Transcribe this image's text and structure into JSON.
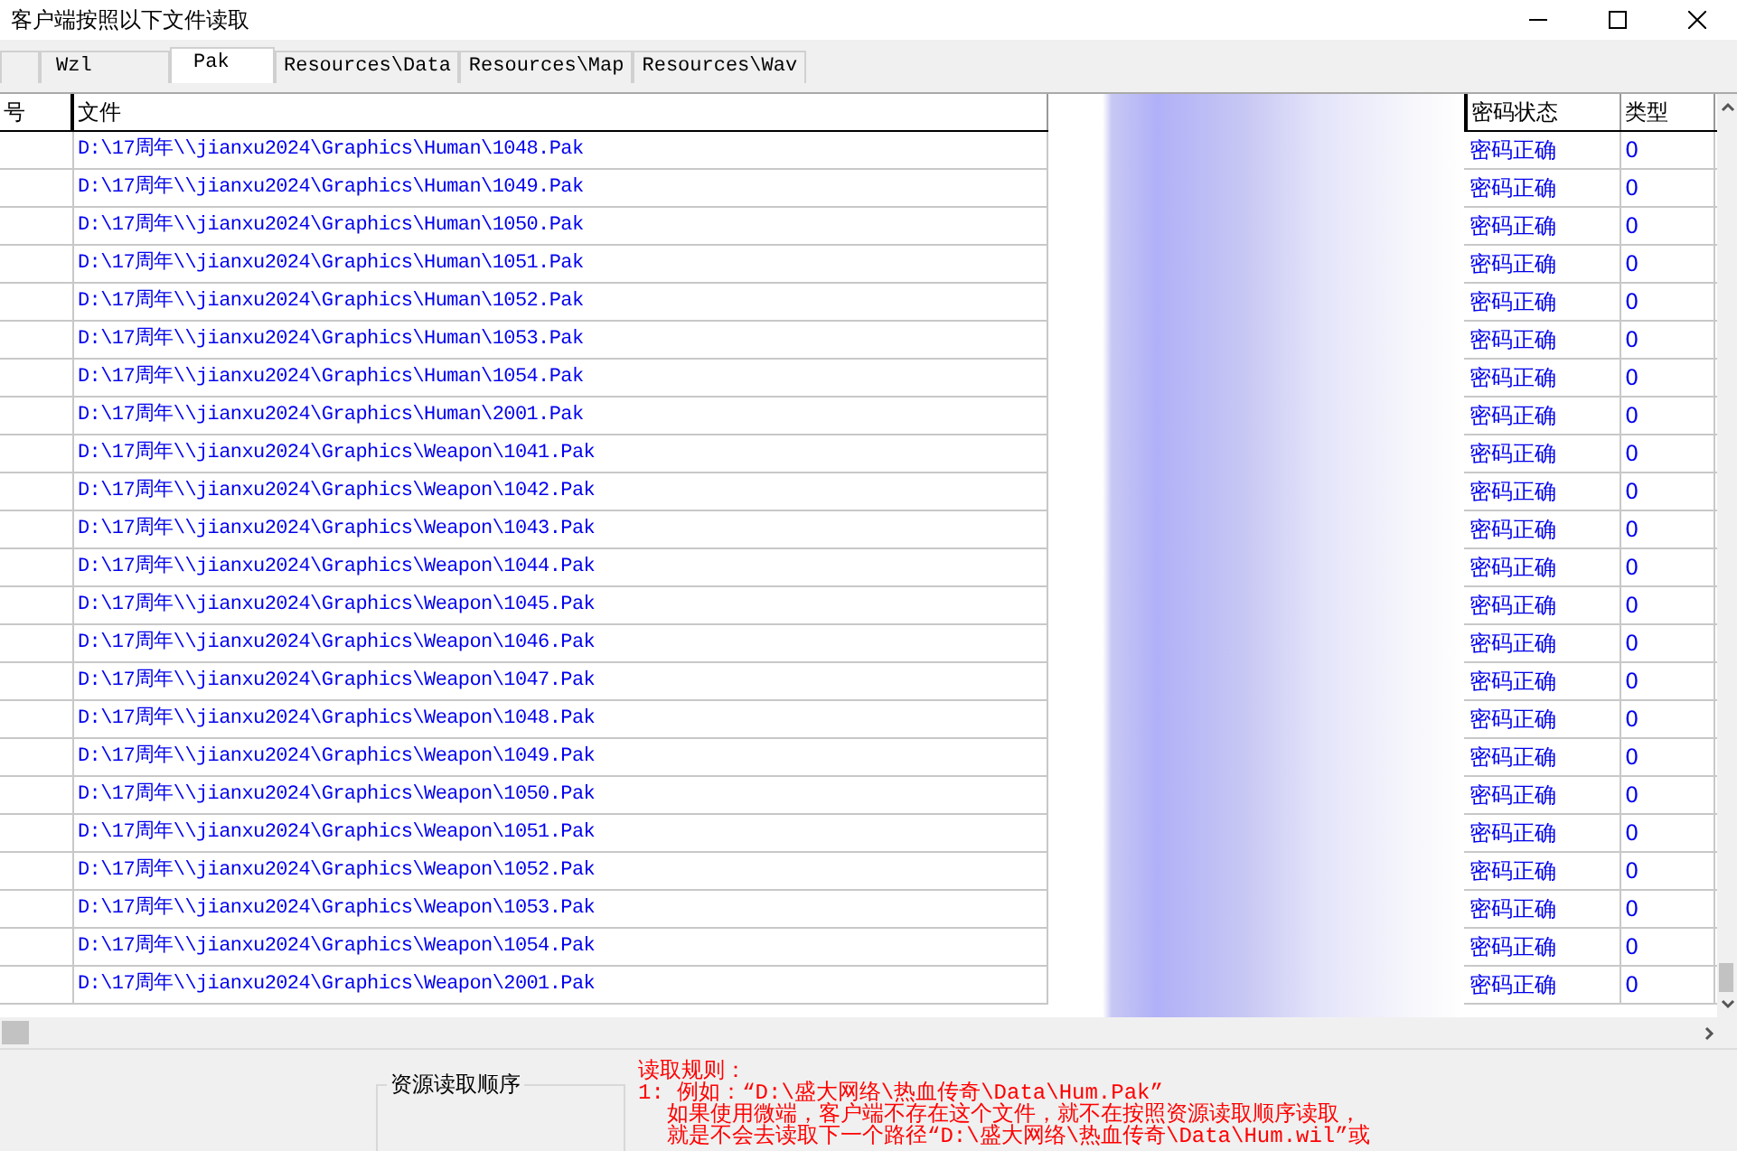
{
  "window": {
    "title": "客户端按照以下文件读取"
  },
  "tabs": [
    {
      "selected": false
    },
    {
      "label": "Wzl",
      "selected": false
    },
    {
      "label": "Pak",
      "selected": true
    },
    {
      "label": "Resources\\Data",
      "selected": false
    },
    {
      "label": "Resources\\Map",
      "selected": false
    },
    {
      "label": "Resources\\Wav",
      "selected": false
    }
  ],
  "table": {
    "columns": [
      "号",
      "文件",
      "密码状态",
      "类型"
    ],
    "rows": [
      {
        "file": "D:\\17周年\\\\jianxu2024\\Graphics\\Human\\1048.Pak",
        "status": "密码正确",
        "type": "0"
      },
      {
        "file": "D:\\17周年\\\\jianxu2024\\Graphics\\Human\\1049.Pak",
        "status": "密码正确",
        "type": "0"
      },
      {
        "file": "D:\\17周年\\\\jianxu2024\\Graphics\\Human\\1050.Pak",
        "status": "密码正确",
        "type": "0"
      },
      {
        "file": "D:\\17周年\\\\jianxu2024\\Graphics\\Human\\1051.Pak",
        "status": "密码正确",
        "type": "0"
      },
      {
        "file": "D:\\17周年\\\\jianxu2024\\Graphics\\Human\\1052.Pak",
        "status": "密码正确",
        "type": "0"
      },
      {
        "file": "D:\\17周年\\\\jianxu2024\\Graphics\\Human\\1053.Pak",
        "status": "密码正确",
        "type": "0"
      },
      {
        "file": "D:\\17周年\\\\jianxu2024\\Graphics\\Human\\1054.Pak",
        "status": "密码正确",
        "type": "0"
      },
      {
        "file": "D:\\17周年\\\\jianxu2024\\Graphics\\Human\\2001.Pak",
        "status": "密码正确",
        "type": "0"
      },
      {
        "file": "D:\\17周年\\\\jianxu2024\\Graphics\\Weapon\\1041.Pak",
        "status": "密码正确",
        "type": "0"
      },
      {
        "file": "D:\\17周年\\\\jianxu2024\\Graphics\\Weapon\\1042.Pak",
        "status": "密码正确",
        "type": "0"
      },
      {
        "file": "D:\\17周年\\\\jianxu2024\\Graphics\\Weapon\\1043.Pak",
        "status": "密码正确",
        "type": "0"
      },
      {
        "file": "D:\\17周年\\\\jianxu2024\\Graphics\\Weapon\\1044.Pak",
        "status": "密码正确",
        "type": "0"
      },
      {
        "file": "D:\\17周年\\\\jianxu2024\\Graphics\\Weapon\\1045.Pak",
        "status": "密码正确",
        "type": "0"
      },
      {
        "file": "D:\\17周年\\\\jianxu2024\\Graphics\\Weapon\\1046.Pak",
        "status": "密码正确",
        "type": "0"
      },
      {
        "file": "D:\\17周年\\\\jianxu2024\\Graphics\\Weapon\\1047.Pak",
        "status": "密码正确",
        "type": "0"
      },
      {
        "file": "D:\\17周年\\\\jianxu2024\\Graphics\\Weapon\\1048.Pak",
        "status": "密码正确",
        "type": "0"
      },
      {
        "file": "D:\\17周年\\\\jianxu2024\\Graphics\\Weapon\\1049.Pak",
        "status": "密码正确",
        "type": "0"
      },
      {
        "file": "D:\\17周年\\\\jianxu2024\\Graphics\\Weapon\\1050.Pak",
        "status": "密码正确",
        "type": "0"
      },
      {
        "file": "D:\\17周年\\\\jianxu2024\\Graphics\\Weapon\\1051.Pak",
        "status": "密码正确",
        "type": "0"
      },
      {
        "file": "D:\\17周年\\\\jianxu2024\\Graphics\\Weapon\\1052.Pak",
        "status": "密码正确",
        "type": "0"
      },
      {
        "file": "D:\\17周年\\\\jianxu2024\\Graphics\\Weapon\\1053.Pak",
        "status": "密码正确",
        "type": "0"
      },
      {
        "file": "D:\\17周年\\\\jianxu2024\\Graphics\\Weapon\\1054.Pak",
        "status": "密码正确",
        "type": "0"
      },
      {
        "file": "D:\\17周年\\\\jianxu2024\\Graphics\\Weapon\\2001.Pak",
        "status": "密码正确",
        "type": "0"
      }
    ]
  },
  "order_group": {
    "title": "资源读取顺序"
  },
  "rules": [
    "读取规则：",
    "1: 例如：“D:\\盛大网络\\热血传奇\\Data\\Hum.Pak”",
    "如果使用微端，客户端不存在这个文件，就不在按照资源读取顺序读取，",
    "就是不会去读取下一个路径“D:\\盛大网络\\热血传奇\\Data\\Hum.wil”或"
  ]
}
